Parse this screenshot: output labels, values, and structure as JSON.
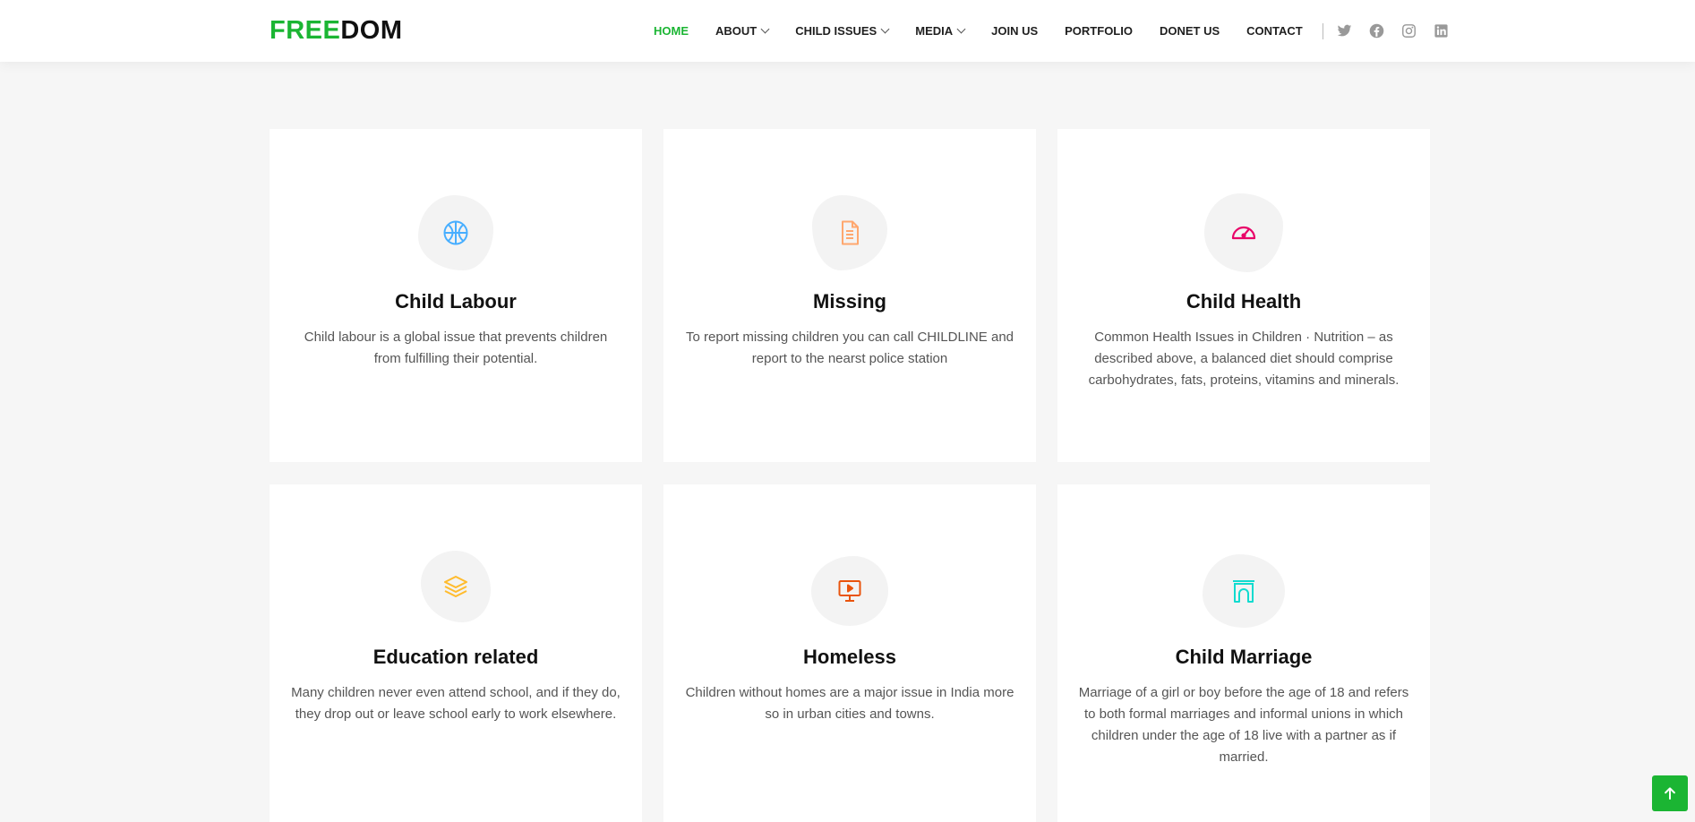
{
  "brand": {
    "part1": "FREE",
    "part2": "DOM",
    "accent_color": "#1bb533"
  },
  "nav": {
    "items": [
      {
        "label": "HOME",
        "active": true
      },
      {
        "label": "ABOUT",
        "dropdown": true
      },
      {
        "label": "CHILD ISSUES",
        "dropdown": true
      },
      {
        "label": "MEDIA",
        "dropdown": true
      },
      {
        "label": "JOIN US"
      },
      {
        "label": "PORTFOLIO"
      },
      {
        "label": "DONET US"
      },
      {
        "label": "CONTACT"
      }
    ],
    "social": [
      "twitter-icon",
      "facebook-icon",
      "instagram-icon",
      "linkedin-icon"
    ]
  },
  "cards": [
    {
      "title": "Child Labour",
      "text": "Child labour is a global issue that prevents children from fulfilling their potential.",
      "icon": "basketball-icon",
      "icon_color": "#47aeff"
    },
    {
      "title": "Missing",
      "text": "To report missing children you can call CHILDLINE and report to the nearst police station",
      "icon": "document-icon",
      "icon_color": "#ffa76e"
    },
    {
      "title": "Child Health",
      "text": "Common Health Issues in Children · Nutrition – as described above, a balanced diet should comprise carbohydrates, fats, proteins, vitamins and minerals.",
      "icon": "speedometer-icon",
      "icon_color": "#e80368"
    },
    {
      "title": "Education related",
      "text": "Many children never even attend school, and if they do, they drop out or leave school early to work elsewhere.",
      "icon": "layers-icon",
      "icon_color": "#ffbb2c"
    },
    {
      "title": "Homeless",
      "text": "Children without homes are a major issue in India more so in urban cities and towns.",
      "icon": "presentation-icon",
      "icon_color": "#e9540d"
    },
    {
      "title": "Child Marriage",
      "text": "Marriage of a girl or boy before the age of 18 and refers to both formal marriages and informal unions in which children under the age of 18 live with a partner as if married.",
      "icon": "archway-icon",
      "icon_color": "#11dbcf"
    }
  ],
  "back_to_top": {
    "icon": "arrow-up-icon"
  }
}
